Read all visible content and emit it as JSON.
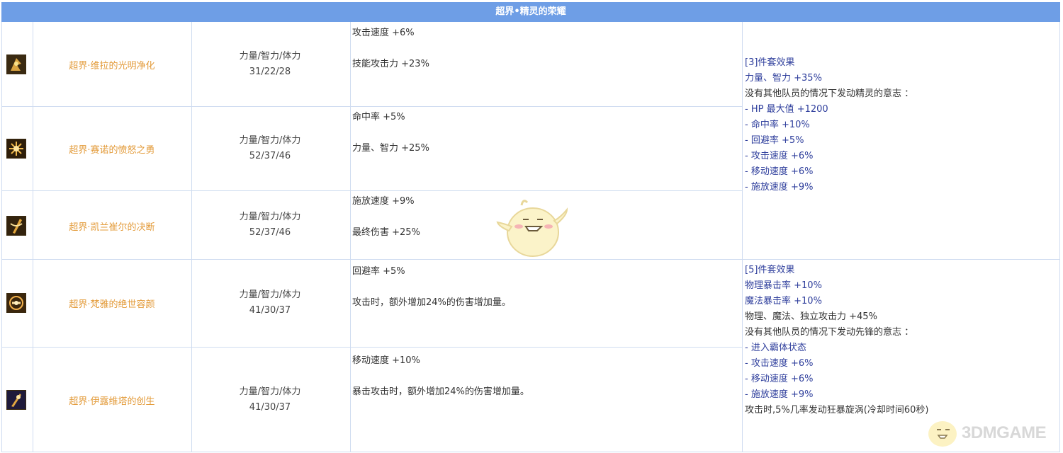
{
  "header": {
    "title": "超界•精灵的荣耀"
  },
  "rows": [
    {
      "name": "超界·维拉的光明净化",
      "stat_label": "力量/智力/体力",
      "stat_values": "31/22/28",
      "opt1": "攻击速度 +6%",
      "opt2": "技能攻击力 +23%",
      "icon": "relic-icon-vira"
    },
    {
      "name": "超界·赛诺的愤怒之勇",
      "stat_label": "力量/智力/体力",
      "stat_values": "52/37/46",
      "opt1": "命中率 +5%",
      "opt2": "力量、智力 +25%",
      "icon": "relic-icon-seno"
    },
    {
      "name": "超界·凯兰崔尔的决断",
      "stat_label": "力量/智力/体力",
      "stat_values": "52/37/46",
      "opt1": "施放速度 +9%",
      "opt2": "最终伤害 +25%",
      "icon": "relic-icon-kelan"
    },
    {
      "name": "超界·梵雅的绝世容颜",
      "stat_label": "力量/智力/体力",
      "stat_values": "41/30/37",
      "opt1": "回避率 +5%",
      "opt2": "攻击时，额外增加24%的伤害增加量。",
      "icon": "relic-icon-fanya"
    },
    {
      "name": "超界·伊露维塔的创生",
      "stat_label": "力量/智力/体力",
      "stat_values": "41/30/37",
      "opt1": "移动速度 +10%",
      "opt2": "暴击攻击时，额外增加24%的伤害增加量。",
      "icon": "relic-icon-yilu"
    }
  ],
  "set3": [
    "[3]件套效果",
    "力量、智力 +35%",
    "没有其他队员的情况下发动精灵的意志 ：",
    "- HP 最大值 +1200",
    "- 命中率 +10%",
    "- 回避率 +5%",
    "- 攻击速度 +6%",
    "- 移动速度 +6%",
    "- 施放速度 +9%"
  ],
  "set5": [
    "[5]件套效果",
    "物理暴击率 +10%",
    "魔法暴击率 +10%",
    "物理、魔法、独立攻击力 +45%",
    "没有其他队员的情况下发动先锋的意志 ：",
    "- 进入霸体状态",
    "- 攻击速度 +6%",
    "- 移动速度 +6%",
    "- 施放速度 +9%",
    "攻击时,5%几率发动狂暴旋涡(冷却时间60秒)"
  ],
  "watermark": {
    "text": "3DMGAME"
  },
  "colors": {
    "banner": "#6e9ee6",
    "name": "#e39b3a",
    "set_blue": "#2e3e9c",
    "grid": "#cfdcf0"
  }
}
